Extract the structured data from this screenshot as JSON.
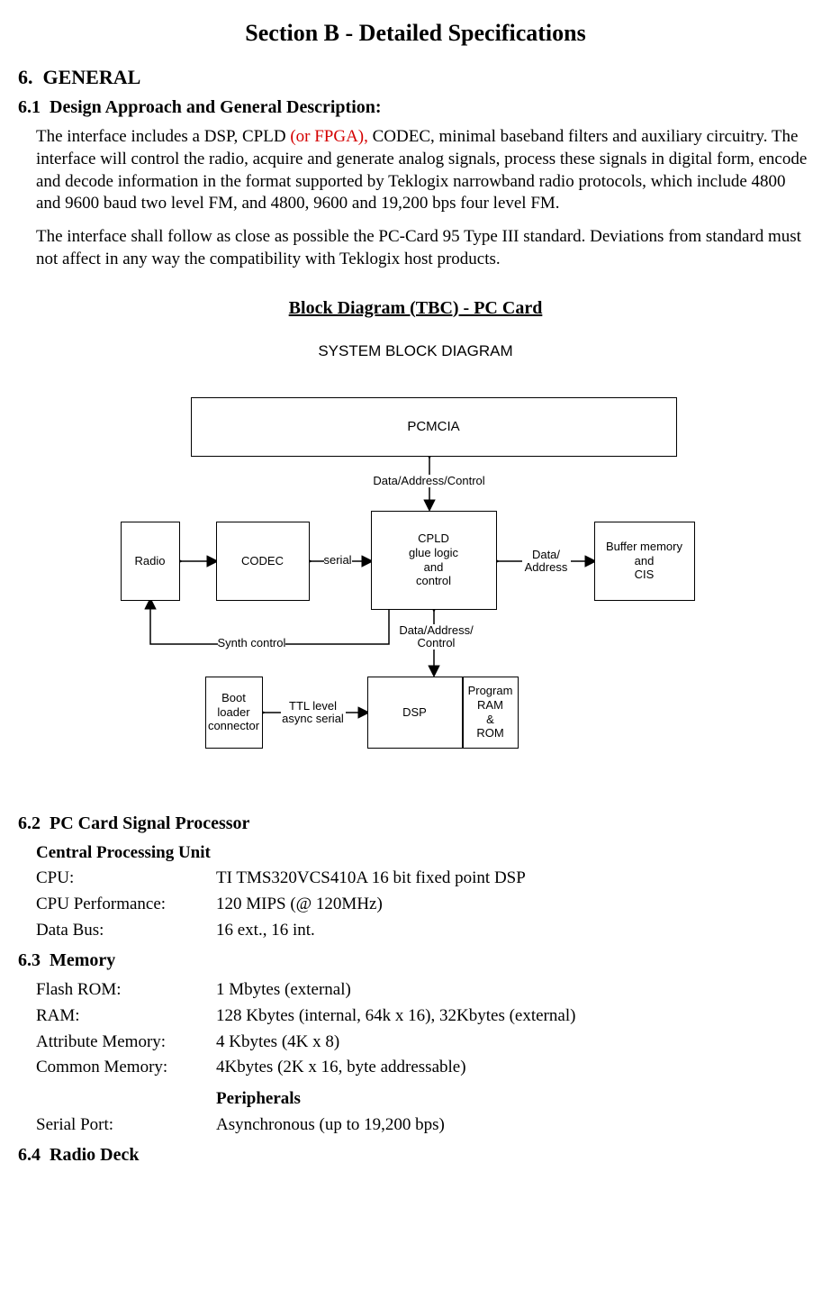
{
  "title": "Section B - Detailed Specifications",
  "s6": {
    "num": "6.",
    "label": "GENERAL"
  },
  "s61": {
    "num": "6.1",
    "label": "Design Approach and General Description:"
  },
  "para1a": "The interface includes a DSP, CPLD ",
  "para1red": "(or FPGA),",
  "para1b": " CODEC, minimal baseband filters and auxiliary circuitry. The interface will control the radio, acquire and generate analog signals, process these signals in digital form, encode and decode information in the format supported by Teklogix narrowband radio protocols, which include 4800 and 9600 baud two level FM, and 4800, 9600 and 19,200 bps four level FM.",
  "para2": "The interface shall follow as close as possible the PC-Card 95 Type III standard. Deviations from standard must not affect in any way the compatibility with Teklogix host products.",
  "bd_title": "Block Diagram (TBC) - PC Card",
  "sbd": "SYSTEM BLOCK DIAGRAM",
  "diagram": {
    "pcmcia": "PCMCIA",
    "dac": "Data/Address/Control",
    "radio": "Radio",
    "codec": "CODEC",
    "serial": "serial",
    "cpld": "CPLD\nglue logic\nand\ncontrol",
    "da": "Data/\nAddress",
    "buffer": "Buffer memory\nand\nCIS",
    "synth": "Synth control",
    "dac2": "Data/Address/\nControl",
    "boot": "Boot\nloader\nconnector",
    "ttl": "TTL level\nasync serial",
    "dsp": "DSP",
    "prog": "Program\nRAM\n&\nROM"
  },
  "s62": {
    "num": "6.2",
    "label": "PC Card Signal Processor"
  },
  "cpu_head": "Central Processing Unit",
  "specs62": [
    {
      "l": "CPU:",
      "v": "TI TMS320VCS410A 16 bit fixed point DSP"
    },
    {
      "l": "CPU Performance:",
      "v": "120 MIPS (@ 120MHz)"
    },
    {
      "l": "Data Bus:",
      "v": "16 ext., 16 int."
    }
  ],
  "s63": {
    "num": "6.3",
    "label": "Memory"
  },
  "specs63": [
    {
      "l": "Flash ROM:",
      "v": "1 Mbytes (external)"
    },
    {
      "l": "RAM:",
      "v": "128 Kbytes (internal, 64k x 16), 32Kbytes (external)"
    },
    {
      "l": "Attribute Memory:",
      "v": " 4 Kbytes (4K x 8)"
    },
    {
      "l": "Common Memory:",
      "v": "4Kbytes (2K x 16, byte addressable)"
    }
  ],
  "periph_head": "Peripherals",
  "specs63b": [
    {
      "l": "Serial Port:",
      "v": "Asynchronous (up to 19,200 bps)"
    }
  ],
  "s64": {
    "num": "6.4",
    "label": "Radio Deck"
  }
}
